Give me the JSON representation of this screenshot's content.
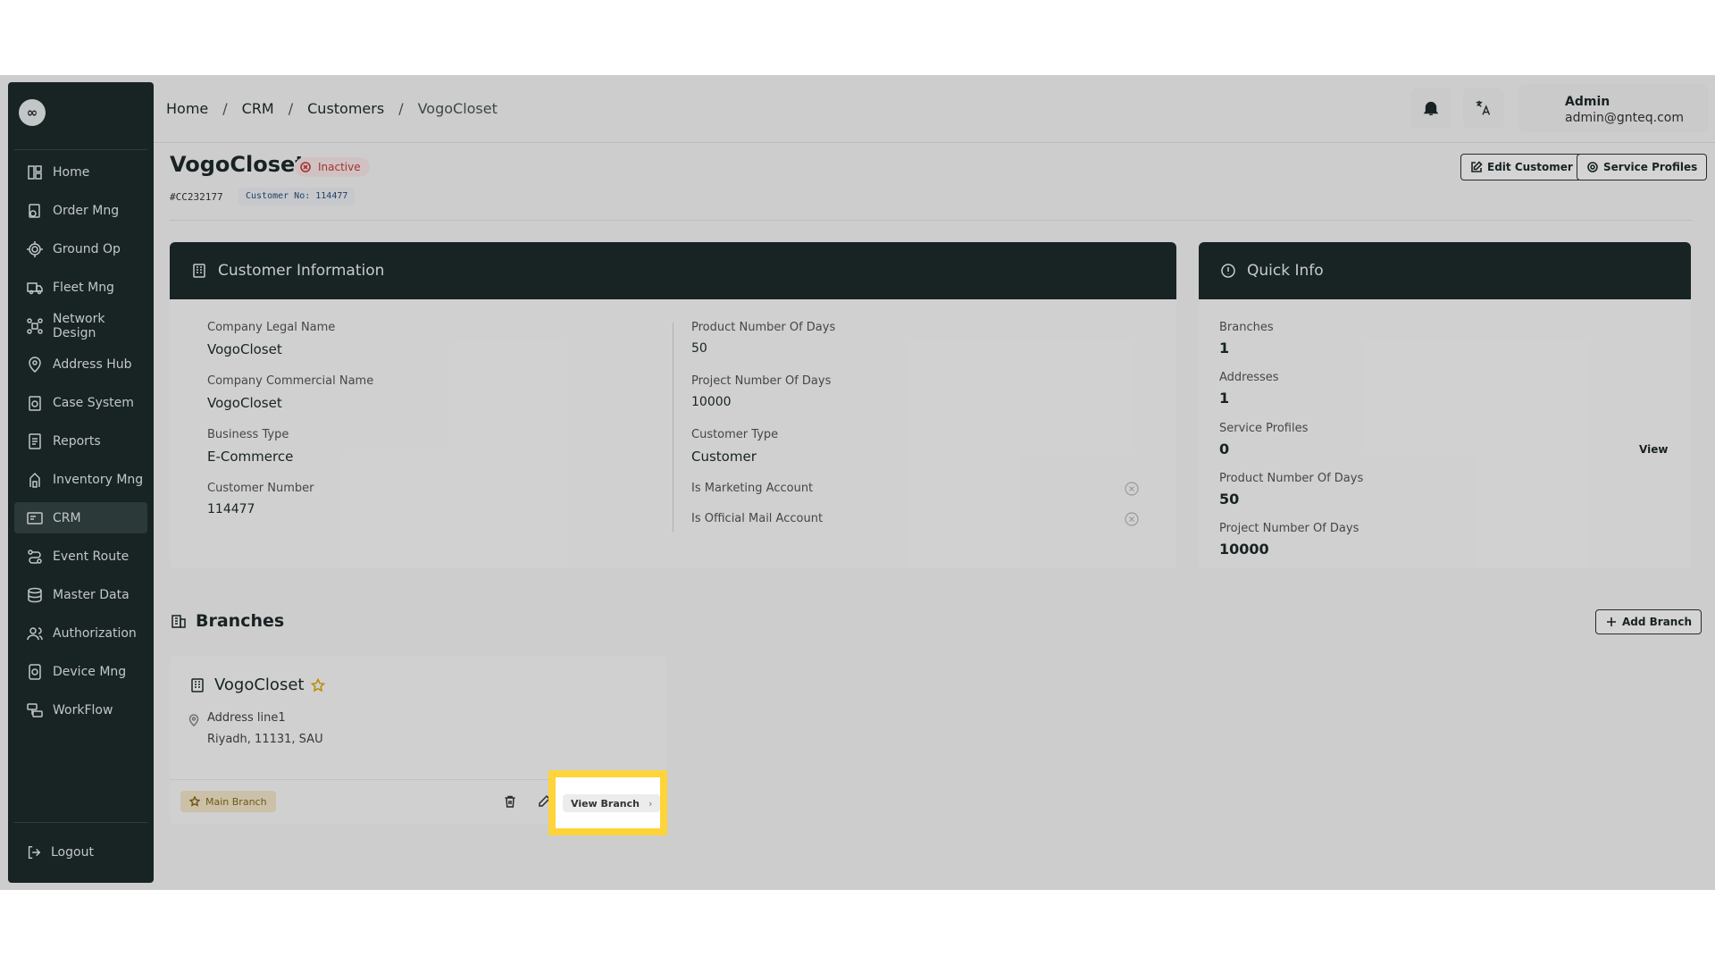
{
  "sidebar": {
    "logo": "∞",
    "items": [
      {
        "label": "Home",
        "icon": "home-grid-icon"
      },
      {
        "label": "Order Mng",
        "icon": "order-icon"
      },
      {
        "label": "Ground Op",
        "icon": "ground-op-icon"
      },
      {
        "label": "Fleet Mng",
        "icon": "truck-icon"
      },
      {
        "label": "Network Design",
        "icon": "network-icon"
      },
      {
        "label": "Address Hub",
        "icon": "map-pin-icon"
      },
      {
        "label": "Case System",
        "icon": "case-icon"
      },
      {
        "label": "Reports",
        "icon": "report-icon"
      },
      {
        "label": "Inventory Mng",
        "icon": "inventory-icon"
      },
      {
        "label": "CRM",
        "icon": "crm-icon"
      },
      {
        "label": "Event Route",
        "icon": "route-icon"
      },
      {
        "label": "Master Data",
        "icon": "database-icon"
      },
      {
        "label": "Authorization",
        "icon": "users-icon"
      },
      {
        "label": "Device Mng",
        "icon": "device-icon"
      },
      {
        "label": "WorkFlow",
        "icon": "workflow-icon"
      }
    ],
    "active": "CRM",
    "logout": "Logout"
  },
  "breadcrumb": [
    "Home",
    "CRM",
    "Customers",
    "VogoCloset"
  ],
  "user": {
    "name": "Admin",
    "email": "admin@gnteq.com"
  },
  "customer": {
    "title": "VogoCloset",
    "status": "Inactive",
    "id": "#CC232177",
    "customer_no": "Customer No: 114477"
  },
  "actions": {
    "edit": "Edit Customer",
    "service": "Service Profiles",
    "add_branch": "Add Branch"
  },
  "info": {
    "heading": "Customer Information",
    "left": [
      {
        "label": "Company Legal Name",
        "value": "VogoCloset"
      },
      {
        "label": "Company Commercial Name",
        "value": "VogoCloset"
      },
      {
        "label": "Business Type",
        "value": "E-Commerce"
      },
      {
        "label": "Customer Number",
        "value": "114477"
      }
    ],
    "right": [
      {
        "label": "Product Number Of Days",
        "value": "50"
      },
      {
        "label": "Project Number Of Days",
        "value": "10000"
      },
      {
        "label": "Customer Type",
        "value": "Customer"
      },
      {
        "label": "Is Marketing Account"
      },
      {
        "label": "Is Official Mail Account"
      }
    ]
  },
  "quick": {
    "heading": "Quick Info",
    "items": [
      {
        "label": "Branches",
        "value": "1"
      },
      {
        "label": "Addresses",
        "value": "1"
      },
      {
        "label": "Service Profiles",
        "value": "0",
        "link": "View"
      },
      {
        "label": "Product Number Of Days",
        "value": "50"
      },
      {
        "label": "Project Number Of Days",
        "value": "10000"
      }
    ]
  },
  "branches": {
    "heading": "Branches",
    "list": [
      {
        "name": "VogoCloset",
        "address1": "Address line1",
        "address2": "Riyadh, 11131, SAU",
        "badge": "Main Branch",
        "view": "View Branch"
      }
    ]
  },
  "colors": {
    "sidebar": "#1d2b2b",
    "highlight": "#ffd43b",
    "inactive": "#c73c3c",
    "main_badge": "#f4e8cc"
  }
}
